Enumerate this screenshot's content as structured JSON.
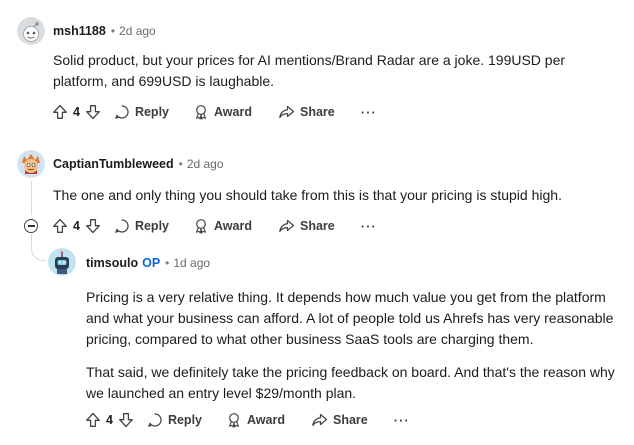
{
  "comments": [
    {
      "author": "msh1188",
      "time": "2d ago",
      "paragraphs": [
        "Solid product, but your prices for AI mentions/Brand Radar are a joke. 199USD per platform, and 699USD is laughable."
      ],
      "votes": "4"
    },
    {
      "author": "CaptianTumbleweed",
      "time": "2d ago",
      "paragraphs": [
        "The one and only thing you should take from this is that your pricing is stupid high."
      ],
      "votes": "4"
    },
    {
      "author": "timsoulo",
      "op_badge": "OP",
      "time": "1d ago",
      "paragraphs": [
        "Pricing is a very relative thing. It depends how much value you get from the platform and what your business can afford. A lot of people told us Ahrefs has very reasonable pricing, compared to what other business SaaS tools are charging them.",
        "That said, we definitely take the pricing feedback on board. And that's the reason why we launched an entry level $29/month plan."
      ],
      "votes": "4"
    }
  ],
  "actions": {
    "reply": "Reply",
    "award": "Award",
    "share": "Share",
    "more": "···"
  },
  "separator": "•"
}
